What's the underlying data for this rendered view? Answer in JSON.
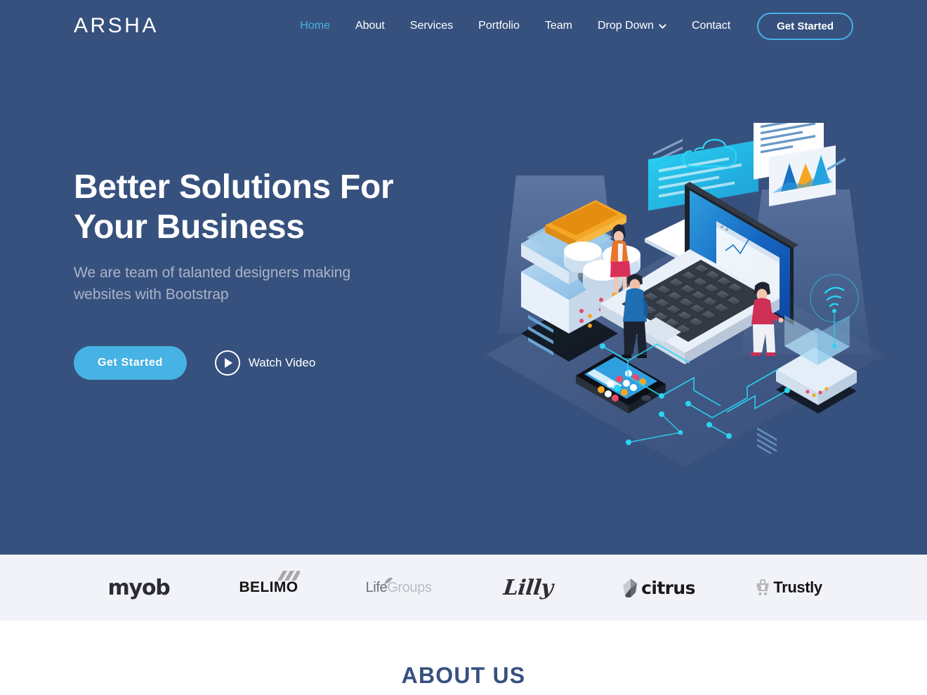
{
  "header": {
    "logo": "ARSHA",
    "nav": [
      {
        "label": "Home",
        "active": true
      },
      {
        "label": "About",
        "active": false
      },
      {
        "label": "Services",
        "active": false
      },
      {
        "label": "Portfolio",
        "active": false
      },
      {
        "label": "Team",
        "active": false
      },
      {
        "label": "Drop Down",
        "active": false,
        "icon": "chevron-down-icon"
      },
      {
        "label": "Contact",
        "active": false
      }
    ],
    "cta_label": "Get Started"
  },
  "hero": {
    "title_line1": "Better Solutions For",
    "title_line2": "Your Business",
    "subtitle": "We are team of talanted designers making websites with Bootstrap",
    "primary_cta": "Get Started",
    "secondary_cta": "Watch Video",
    "secondary_icon": "play-icon",
    "illustration": "isometric-laptop-servers-team-illustration",
    "background_color": "#37517e",
    "accent_color": "#47b2e4",
    "subtitle_color": "#aab4c7"
  },
  "clients": {
    "background_color": "#f1f3f8",
    "logos": [
      {
        "name": "myob",
        "text": "myob"
      },
      {
        "name": "belimo",
        "text": "BELIMO"
      },
      {
        "name": "lifegroups",
        "text_a": "Life",
        "text_b": "Groups"
      },
      {
        "name": "lilly",
        "text": "Lilly"
      },
      {
        "name": "citrus",
        "text": "citrus"
      },
      {
        "name": "trustly",
        "text": "Trustly"
      }
    ]
  },
  "about": {
    "title": "ABOUT US",
    "title_color": "#37517e"
  }
}
